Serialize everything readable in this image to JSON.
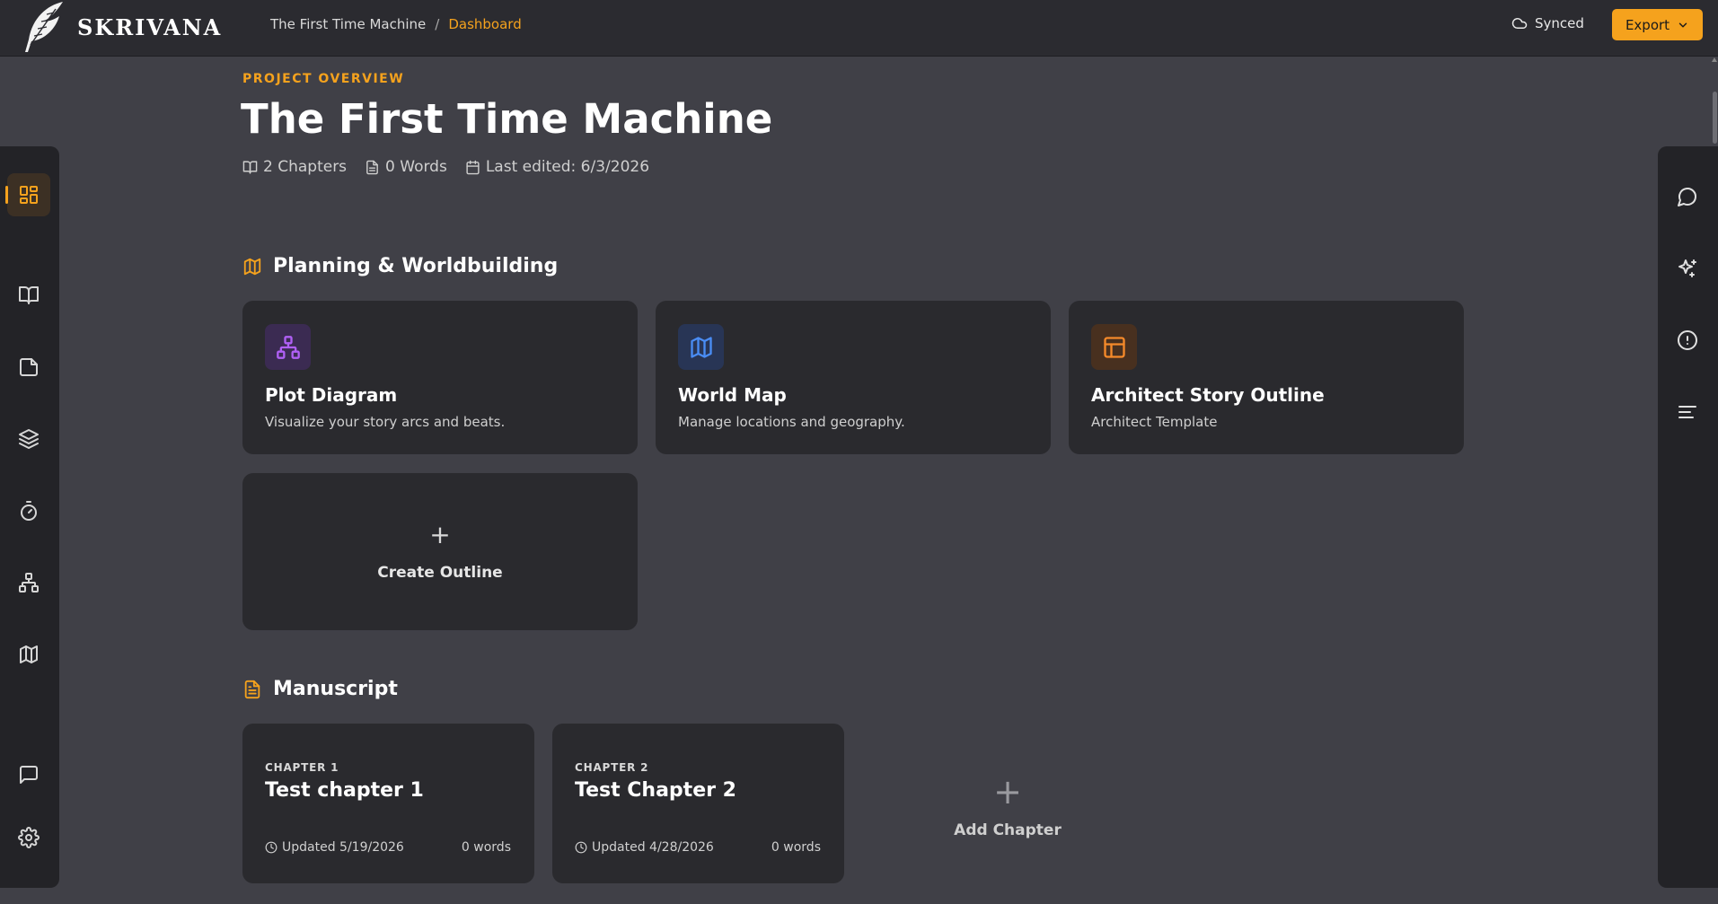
{
  "app": {
    "name": "SKRIVANA"
  },
  "breadcrumb": {
    "project": "The First Time Machine",
    "separator": "/",
    "current": "Dashboard"
  },
  "header": {
    "sync_status": "Synced",
    "export_label": "Export"
  },
  "overview": {
    "eyebrow": "PROJECT OVERVIEW",
    "title": "The First Time Machine",
    "chapters": "2 Chapters",
    "words": "0 Words",
    "last_edited": "Last edited: 6/3/2026"
  },
  "planning": {
    "heading": "Planning & Worldbuilding",
    "cards": [
      {
        "title": "Plot Diagram",
        "subtitle": "Visualize your story arcs and beats.",
        "icon": "plot-diagram-icon",
        "color": "#a855f7"
      },
      {
        "title": "World Map",
        "subtitle": "Manage locations and geography.",
        "icon": "map-icon",
        "color": "#3b82f6"
      },
      {
        "title": "Architect Story Outline",
        "subtitle": "Architect Template",
        "icon": "layout-icon",
        "color": "#f97316"
      }
    ],
    "create_plus": "+",
    "create_label": "Create Outline"
  },
  "manuscript": {
    "heading": "Manuscript",
    "chapters": [
      {
        "label": "CHAPTER 1",
        "title": "Test chapter 1",
        "updated": "Updated 5/19/2026",
        "words": "0 words"
      },
      {
        "label": "CHAPTER 2",
        "title": "Test Chapter 2",
        "updated": "Updated 4/28/2026",
        "words": "0 words"
      }
    ],
    "add_plus": "+",
    "add_label": "Add Chapter"
  },
  "left_rail": [
    "dashboard-icon",
    "book-open-icon",
    "file-icon",
    "layers-icon",
    "timer-icon",
    "plot-diagram-icon",
    "map-icon",
    "message-icon",
    "gear-icon"
  ],
  "right_rail": [
    "chat-bubble-icon",
    "sparkles-icon",
    "alert-circle-icon",
    "align-left-icon"
  ],
  "colors": {
    "accent": "#f5a21d",
    "background": "#404047",
    "card": "#2a2a2e",
    "topbar": "#2b2b30"
  }
}
